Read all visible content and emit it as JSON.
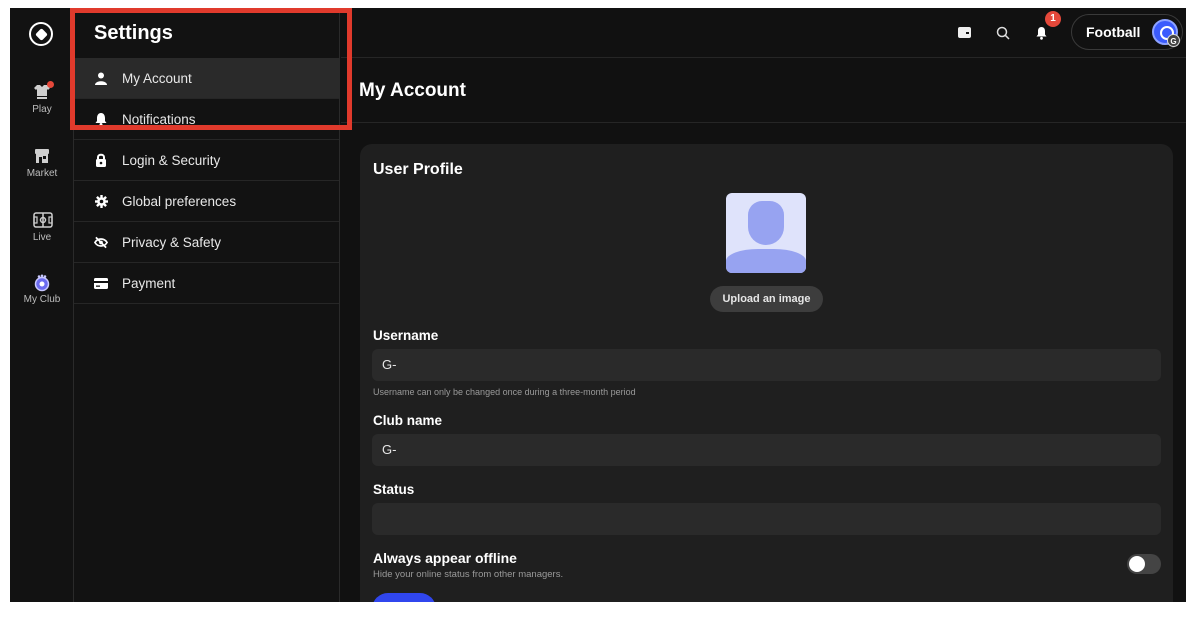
{
  "rail": {
    "items": [
      {
        "label": "Play",
        "icon": "jersey-icon",
        "has_notification_dot": true
      },
      {
        "label": "Market",
        "icon": "store-icon"
      },
      {
        "label": "Live",
        "icon": "pitch-icon"
      },
      {
        "label": "My Club",
        "icon": "club-crest-icon"
      }
    ]
  },
  "settings": {
    "title": "Settings",
    "items": [
      {
        "label": "My Account",
        "icon": "user-icon",
        "active": true
      },
      {
        "label": "Notifications",
        "icon": "bell-icon"
      },
      {
        "label": "Login & Security",
        "icon": "lock-icon"
      },
      {
        "label": "Global preferences",
        "icon": "gear-icon"
      },
      {
        "label": "Privacy & Safety",
        "icon": "eye-off-icon"
      },
      {
        "label": "Payment",
        "icon": "credit-card-icon"
      }
    ]
  },
  "topbar": {
    "notification_count": "1",
    "profile_label": "Football",
    "avatar_initial": "G"
  },
  "page": {
    "title": "My Account"
  },
  "profile_card": {
    "title": "User Profile",
    "upload_label": "Upload an image",
    "username": {
      "label": "Username",
      "value": "G-",
      "hint": "Username can only be changed once during a three-month period"
    },
    "club_name": {
      "label": "Club name",
      "value": "G-"
    },
    "status": {
      "label": "Status",
      "value": ""
    },
    "offline": {
      "label": "Always appear offline",
      "description": "Hide your online status from other managers.",
      "enabled": false
    }
  },
  "colors": {
    "accent_blue": "#3046ee",
    "highlight_red": "#e03a2c",
    "badge_red": "#e5483a",
    "background": "#111111",
    "card": "#1f1f1f"
  }
}
